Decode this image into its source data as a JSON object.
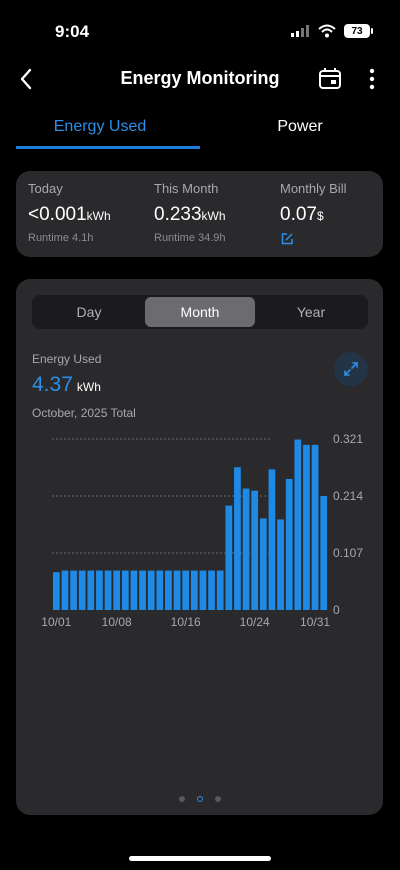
{
  "status": {
    "time": "9:04",
    "battery": "73"
  },
  "nav": {
    "title": "Energy Monitoring"
  },
  "tabs": [
    {
      "label": "Energy Used",
      "active": true
    },
    {
      "label": "Power",
      "active": false
    }
  ],
  "summary": {
    "today": {
      "label": "Today",
      "value": "<0.001",
      "unit": "kWh",
      "sub": "Runtime 4.1h"
    },
    "month": {
      "label": "This Month",
      "value": "0.233",
      "unit": "kWh",
      "sub": "Runtime 34.9h"
    },
    "bill": {
      "label": "Monthly Bill",
      "value": "0.07",
      "unit": "$"
    }
  },
  "segments": [
    {
      "label": "Day",
      "active": false
    },
    {
      "label": "Month",
      "active": true
    },
    {
      "label": "Year",
      "active": false
    }
  ],
  "energy": {
    "label": "Energy Used",
    "value": "4.37",
    "unit": "kWh",
    "period": "October, 2025 Total"
  },
  "colors": {
    "accent": "#2c8ee6",
    "bar": "#1f8ae6",
    "card": "#2a2a2d"
  },
  "chart_data": {
    "type": "bar",
    "x": [
      "10/01",
      "10/02",
      "10/03",
      "10/04",
      "10/05",
      "10/06",
      "10/07",
      "10/08",
      "10/09",
      "10/10",
      "10/11",
      "10/12",
      "10/13",
      "10/14",
      "10/15",
      "10/16",
      "10/17",
      "10/18",
      "10/19",
      "10/20",
      "10/21",
      "10/22",
      "10/23",
      "10/24",
      "10/25",
      "10/26",
      "10/27",
      "10/28",
      "10/29",
      "10/30",
      "10/31"
    ],
    "x_tick_labels": [
      "10/01",
      "10/08",
      "10/16",
      "10/24",
      "10/31"
    ],
    "values": [
      0.071,
      0.074,
      0.074,
      0.074,
      0.074,
      0.074,
      0.074,
      0.074,
      0.074,
      0.074,
      0.074,
      0.074,
      0.074,
      0.074,
      0.074,
      0.074,
      0.074,
      0.074,
      0.074,
      0.074,
      0.196,
      0.268,
      0.228,
      0.224,
      0.172,
      0.264,
      0.17,
      0.246,
      0.32,
      0.31,
      0.31,
      0.214
    ],
    "y_ticks": [
      "0.321",
      "0.214",
      "0.107",
      "0"
    ],
    "ylim": [
      0,
      0.321
    ],
    "grid": true
  },
  "pager": {
    "count": 3,
    "active": 1
  }
}
